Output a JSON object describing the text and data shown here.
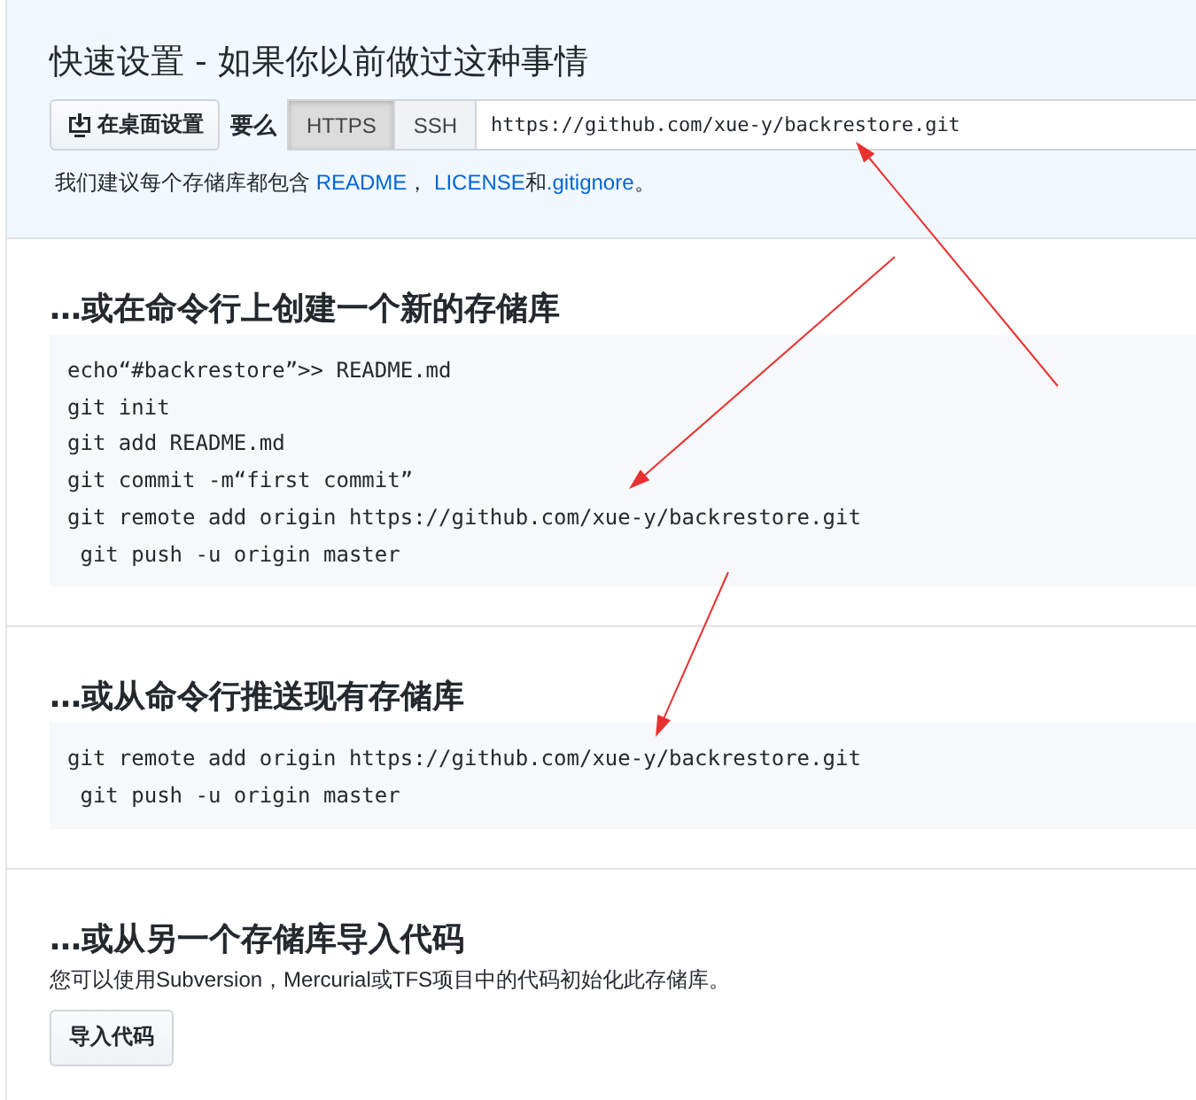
{
  "quick_setup": {
    "title": "快速设置 - 如果你以前做过这种事情",
    "desktop_button": "在桌面设置",
    "or_label": "要么",
    "protocols": [
      {
        "label": "HTTPS",
        "selected": true
      },
      {
        "label": "SSH",
        "selected": false
      }
    ],
    "clone_url": "https://github.com/xue-y/backrestore.git",
    "recommendation": [
      {
        "kind": "text",
        "text": "我们建议每个存储库都包含 "
      },
      {
        "kind": "link",
        "text": "README"
      },
      {
        "kind": "text",
        "text": "， "
      },
      {
        "kind": "link",
        "text": "LICENSE"
      },
      {
        "kind": "text",
        "text": "和"
      },
      {
        "kind": "link",
        "text": ".gitignore"
      },
      {
        "kind": "text",
        "text": "。"
      }
    ]
  },
  "sections": [
    {
      "heading": "…或在命令行上创建一个新的存储库",
      "code_lines": [
        "echo“#backrestore”>> README.md",
        "git init",
        "git add README.md",
        "git commit -m“first commit”",
        "git remote add origin https://github.com/xue-y/backrestore.git",
        " git push -u origin master"
      ]
    },
    {
      "heading": "…或从命令行推送现有存储库",
      "code_lines": [
        "git remote add origin https://github.com/xue-y/backrestore.git",
        " git push -u origin master"
      ]
    }
  ],
  "import": {
    "heading": "…或从另一个存储库导入代码",
    "description": "您可以使用Subversion，Mercurial或TFS项目中的代码初始化此存储库。",
    "button": "导入代码"
  }
}
